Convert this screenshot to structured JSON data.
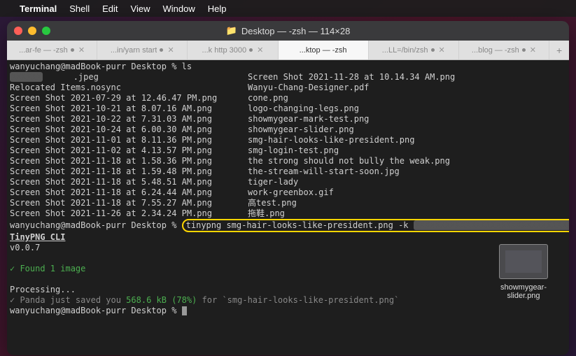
{
  "menubar": {
    "apple": "",
    "app": "Terminal",
    "items": [
      "Shell",
      "Edit",
      "View",
      "Window",
      "Help"
    ]
  },
  "window": {
    "title": "Desktop — -zsh — 114×28"
  },
  "tabs": [
    {
      "label": "...ar-fe — -zsh",
      "dot": true,
      "x": true
    },
    {
      "label": "...in/yarn start",
      "dot": true,
      "x": true
    },
    {
      "label": "...k http 3000",
      "dot": true,
      "x": true
    },
    {
      "label": "...ktop — -zsh",
      "dot": false,
      "x": false,
      "active": true
    },
    {
      "label": "...LL=/bin/zsh",
      "dot": true,
      "x": true
    },
    {
      "label": "...blog — -zsh",
      "dot": true,
      "x": true
    }
  ],
  "terminal": {
    "prompt1": "wanyuchang@madBook-purr Desktop % ",
    "cmd1": "ls",
    "list_col1": [
      "      .jpeg",
      "Relocated Items.nosync",
      "Screen Shot 2021-07-29 at 12.46.47 PM.png",
      "Screen Shot 2021-10-21 at 8.07.16 AM.png",
      "Screen Shot 2021-10-22 at 7.31.03 AM.png",
      "Screen Shot 2021-10-24 at 6.00.30 AM.png",
      "Screen Shot 2021-11-01 at 8.11.36 PM.png",
      "Screen Shot 2021-11-02 at 4.13.57 PM.png",
      "Screen Shot 2021-11-18 at 1.58.36 PM.png",
      "Screen Shot 2021-11-18 at 1.59.48 PM.png",
      "Screen Shot 2021-11-18 at 5.48.51 AM.png",
      "Screen Shot 2021-11-18 at 6.24.44 AM.png",
      "Screen Shot 2021-11-18 at 7.55.27 AM.png",
      "Screen Shot 2021-11-26 at 2.34.24 PM.png"
    ],
    "list_col2": [
      "Screen Shot 2021-11-28 at 10.14.34 AM.png",
      "Wanyu-Chang-Designer.pdf",
      "cone.png",
      "logo-changing-legs.png",
      "showmygear-mark-test.png",
      "showmygear-slider.png",
      "smg-hair-looks-like-president.png",
      "smg-login-test.png",
      "the strong should not bully the weak.png",
      "the-stream-will-start-soon.jpg",
      "tiger-lady",
      "work-greenbox.gif",
      "高test.png",
      "拖鞋.png"
    ],
    "prompt2": "wanyuchang@madBook-purr Desktop % ",
    "cmd2": "tinypng smg-hair-looks-like-president.png -k ",
    "cli_name": "TinyPNG CLI",
    "cli_ver": "v0.0.7",
    "found": "✓ Found 1 image",
    "processing": "Processing...",
    "saved_pre": "✓ Panda just saved you ",
    "saved_kb": "568.6 kB (78%)",
    "saved_post": " for `smg-hair-looks-like-president.png`",
    "prompt3": "wanyuchang@madBook-purr Desktop % "
  },
  "desktop_icon": {
    "filename": "showmygear-slider.png"
  }
}
